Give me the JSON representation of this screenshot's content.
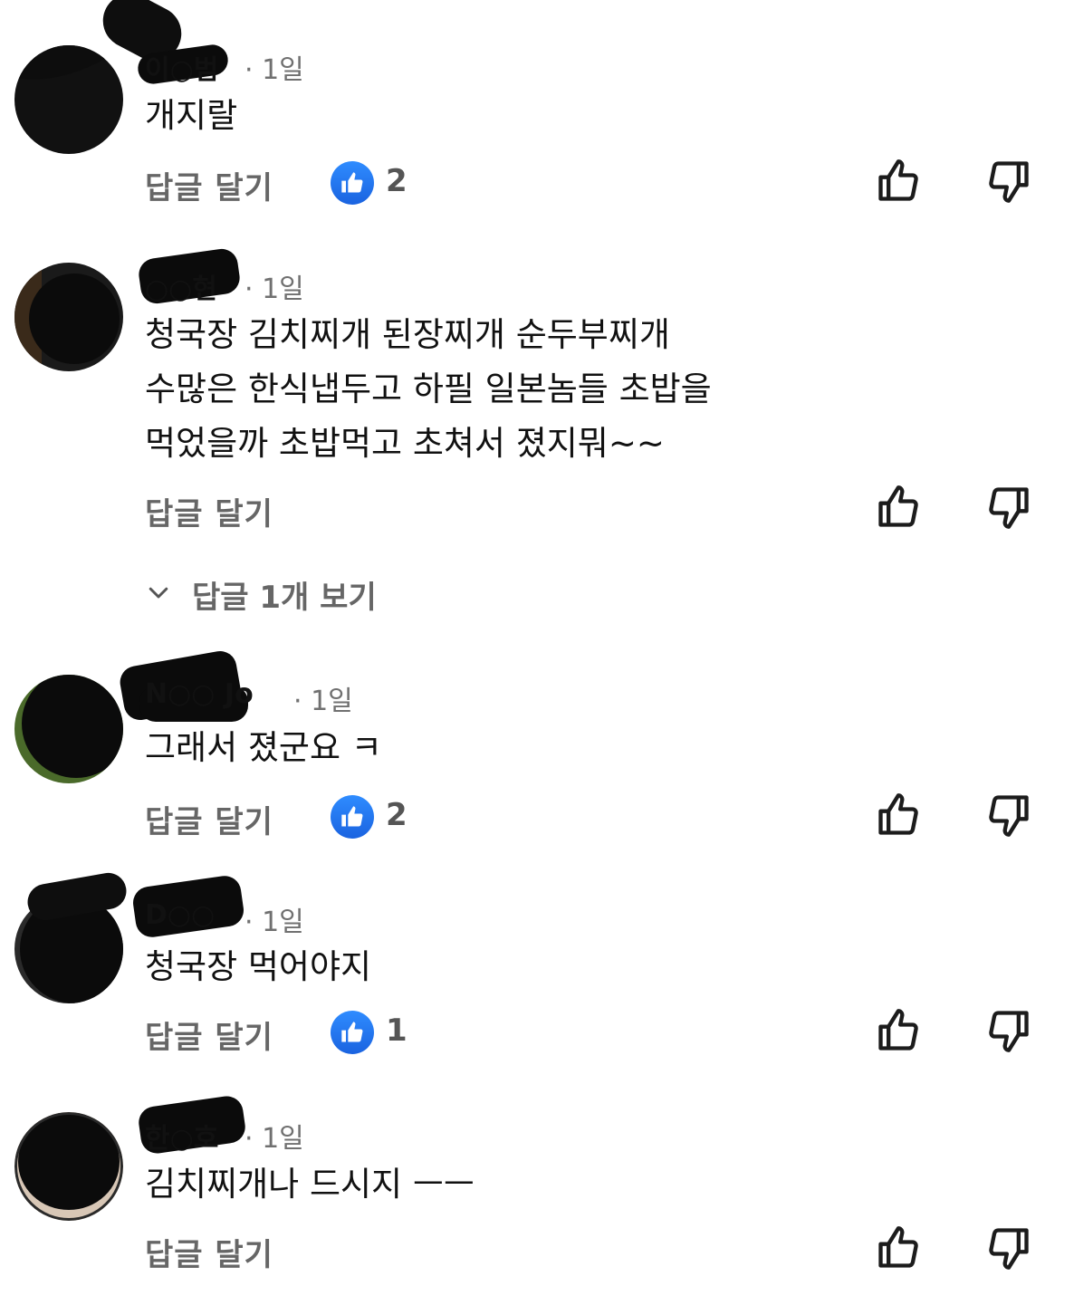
{
  "comments": [
    {
      "author": "이○범",
      "time": "· 1일",
      "text": "개지랄",
      "reply_label": "답글 달기",
      "like_count": "2"
    },
    {
      "author": "○○현",
      "time": "· 1일",
      "text": "청국장 김치찌개 된장찌개 순두부찌개\n수많은 한식냅두고 하필 일본놈들 초밥을\n먹었을까 초밥먹고 초쳐서 졌지뭐~~",
      "reply_label": "답글 달기",
      "view_replies": "답글 1개 보기"
    },
    {
      "author": "N○○ Jo",
      "time": "· 1일",
      "text": "그래서 졌군요 ㅋ",
      "reply_label": "답글 달기",
      "like_count": "2"
    },
    {
      "author": "D○○",
      "time": "· 1일",
      "text": "청국장 먹어야지",
      "reply_label": "답글 달기",
      "like_count": "1"
    },
    {
      "author": "한○호",
      "time": "· 1일",
      "text": "김치찌개나 드시지 ㅡㅡ",
      "reply_label": "답글 달기"
    }
  ],
  "icons": {
    "like_badge": "thumbs-up-icon",
    "vote_up": "thumbs-up-outline-icon",
    "vote_down": "thumbs-down-outline-icon",
    "expand": "chevron-down-icon"
  },
  "colors": {
    "like_badge": "#1a63e0",
    "secondary_text": "#666666"
  }
}
